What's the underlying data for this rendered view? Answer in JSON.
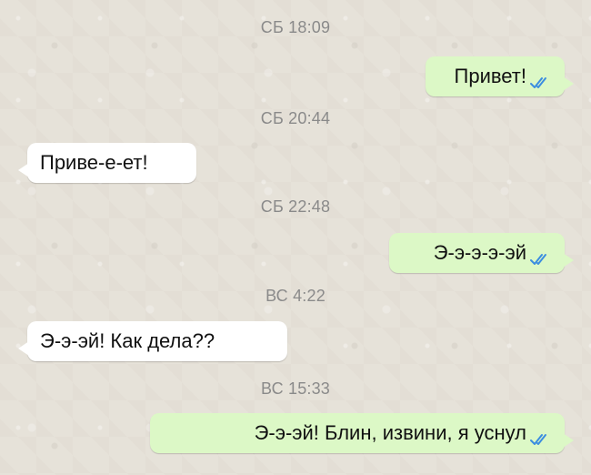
{
  "chat": {
    "messages": [
      {
        "timestamp": "СБ 18:09",
        "direction": "out",
        "text": "Привет!",
        "status_icon": "double-check-icon"
      },
      {
        "timestamp": "СБ 20:44",
        "direction": "in",
        "text": "Приве-е-ет!"
      },
      {
        "timestamp": "СБ 22:48",
        "direction": "out",
        "text": "Э-э-э-э-эй",
        "status_icon": "double-check-icon"
      },
      {
        "timestamp": "ВС  4:22",
        "direction": "in",
        "text": "Э-э-эй! Как дела??"
      },
      {
        "timestamp": "ВС 15:33",
        "direction": "out",
        "text": "Э-э-эй! Блин, извини, я уснул",
        "status_icon": "double-check-icon"
      }
    ]
  },
  "colors": {
    "background": "#e6e2d9",
    "incoming_bubble": "#ffffff",
    "outgoing_bubble": "#dcf8c6",
    "timestamp_text": "#8a8a8a",
    "read_ticks": "#3b8de0"
  }
}
